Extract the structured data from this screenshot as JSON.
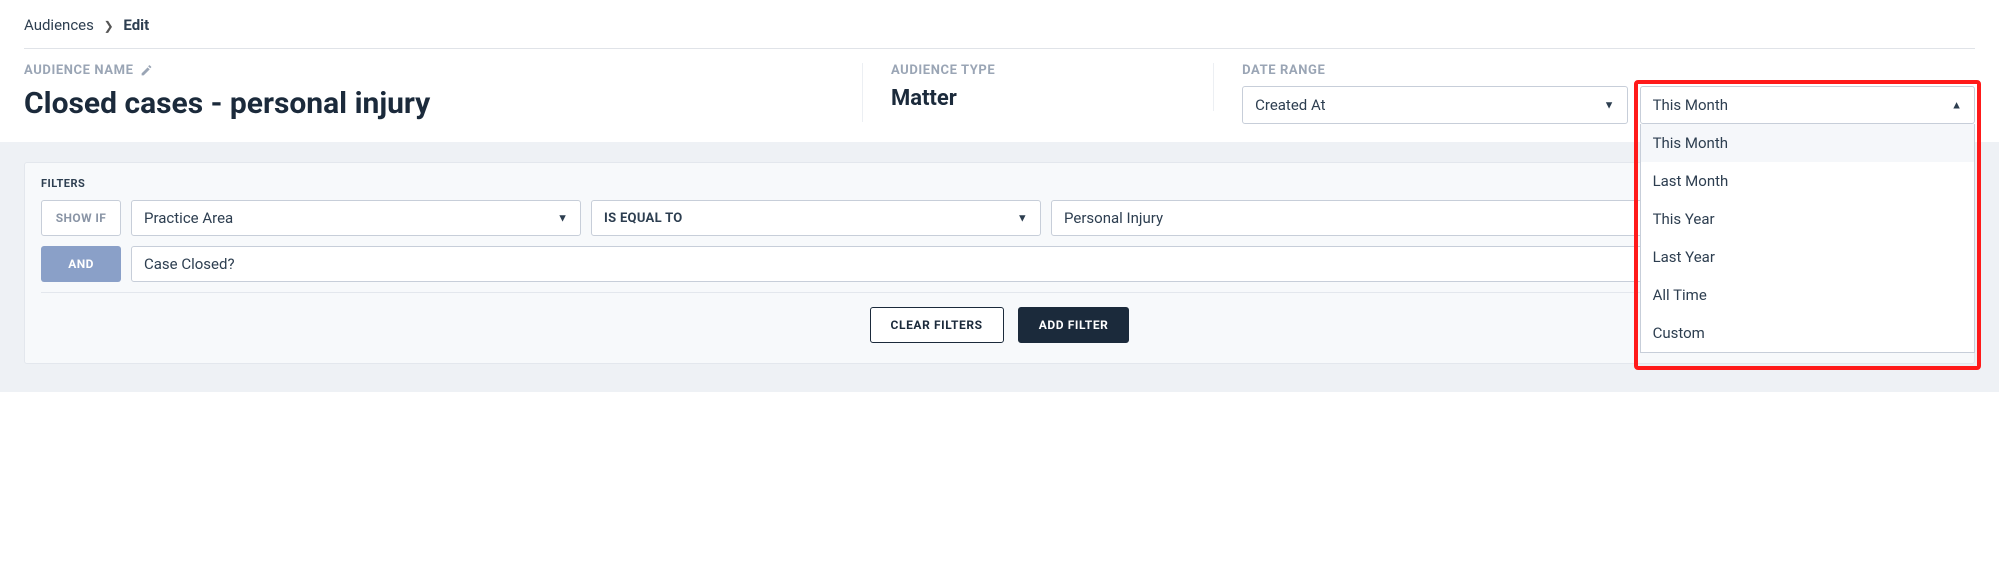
{
  "breadcrumb": {
    "root": "Audiences",
    "current": "Edit"
  },
  "header": {
    "name_label": "AUDIENCE NAME",
    "name_value": "Closed cases - personal injury",
    "type_label": "AUDIENCE TYPE",
    "type_value": "Matter",
    "date_label": "DATE RANGE",
    "date_field": "Created At",
    "date_range_selected": "This Month",
    "date_range_options": [
      "This Month",
      "Last Month",
      "This Year",
      "Last Year",
      "All Time",
      "Custom"
    ]
  },
  "filters": {
    "title": "FILTERS",
    "showif_label": "SHOW IF",
    "and_label": "AND",
    "rows": [
      {
        "field": "Practice Area",
        "op": "IS EQUAL TO",
        "value": "Personal Injury"
      },
      {
        "field": "Case Closed?",
        "value": "True"
      }
    ],
    "clear_label": "CLEAR FILTERS",
    "add_label": "ADD FILTER"
  }
}
